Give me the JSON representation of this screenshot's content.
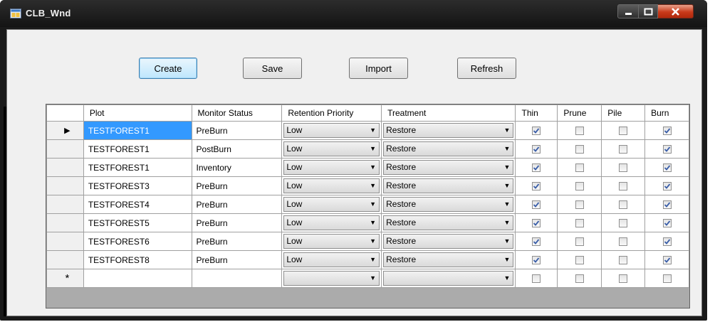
{
  "window": {
    "title": "CLB_Wnd"
  },
  "toolbar": {
    "create_label": "Create",
    "save_label": "Save",
    "import_label": "Import",
    "refresh_label": "Refresh"
  },
  "grid": {
    "columns": [
      "Plot",
      "Monitor Status",
      "Retention Priority",
      "Treatment",
      "Thin",
      "Prune",
      "Pile",
      "Burn"
    ],
    "rows": [
      {
        "plot": "TESTFOREST1",
        "status": "PreBurn",
        "priority": "Low",
        "treatment": "Restore",
        "thin": true,
        "prune": false,
        "pile": false,
        "burn": true
      },
      {
        "plot": "TESTFOREST1",
        "status": "PostBurn",
        "priority": "Low",
        "treatment": "Restore",
        "thin": true,
        "prune": false,
        "pile": false,
        "burn": true
      },
      {
        "plot": "TESTFOREST1",
        "status": "Inventory",
        "priority": "Low",
        "treatment": "Restore",
        "thin": true,
        "prune": false,
        "pile": false,
        "burn": true
      },
      {
        "plot": "TESTFOREST3",
        "status": "PreBurn",
        "priority": "Low",
        "treatment": "Restore",
        "thin": true,
        "prune": false,
        "pile": false,
        "burn": true
      },
      {
        "plot": "TESTFOREST4",
        "status": "PreBurn",
        "priority": "Low",
        "treatment": "Restore",
        "thin": true,
        "prune": false,
        "pile": false,
        "burn": true
      },
      {
        "plot": "TESTFOREST5",
        "status": "PreBurn",
        "priority": "Low",
        "treatment": "Restore",
        "thin": true,
        "prune": false,
        "pile": false,
        "burn": true
      },
      {
        "plot": "TESTFOREST6",
        "status": "PreBurn",
        "priority": "Low",
        "treatment": "Restore",
        "thin": true,
        "prune": false,
        "pile": false,
        "burn": true
      },
      {
        "plot": "TESTFOREST8",
        "status": "PreBurn",
        "priority": "Low",
        "treatment": "Restore",
        "thin": true,
        "prune": false,
        "pile": false,
        "burn": true
      }
    ],
    "new_row_marker": "*",
    "current_row_marker": "▶",
    "selected_row": 0
  },
  "colors": {
    "selection": "#3399ff",
    "check": "#3a5ea8"
  }
}
